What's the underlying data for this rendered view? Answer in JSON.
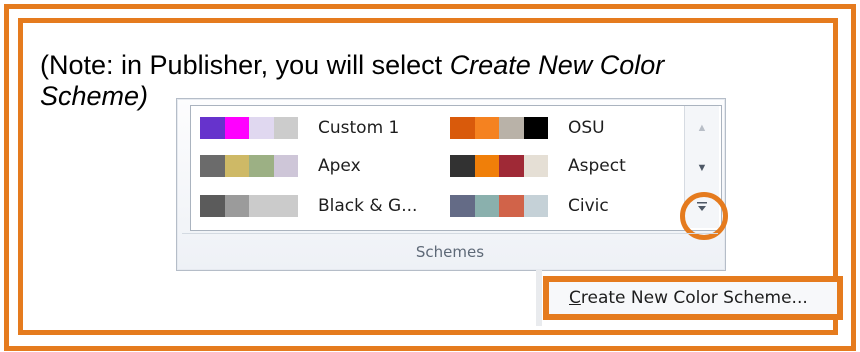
{
  "note": {
    "prefix": "(Note: in Publisher, you will select ",
    "emphasis": "Create New Color Scheme)",
    "first_line_emphasis": "Create New Color",
    "second_line_emphasis": "Scheme)"
  },
  "schemes": [
    {
      "label": "Custom 1",
      "colors": [
        "#6633cc",
        "#ff00ff",
        "#e0d8f0",
        "#cccccc"
      ]
    },
    {
      "label": "OSU",
      "colors": [
        "#d95a0b",
        "#f58220",
        "#b9b2a8",
        "#000000"
      ]
    },
    {
      "label": "Apex",
      "colors": [
        "#6b6b6b",
        "#ceb966",
        "#9cb084",
        "#cec6d8"
      ]
    },
    {
      "label": "Aspect",
      "colors": [
        "#323232",
        "#f07f09",
        "#9f2936",
        "#e5dfd5"
      ]
    },
    {
      "label": "Black & G...",
      "colors": [
        "#5b5b5b",
        "#9b9b9b",
        "#cbcbcb",
        "#cbcbcb"
      ]
    },
    {
      "label": "Civic",
      "colors": [
        "#646b86",
        "#8ab0ad",
        "#d16349",
        "#c5d1d7"
      ]
    }
  ],
  "scrollbar": {
    "up_icon": "▲",
    "down_icon": "▼",
    "more_icon": "▼"
  },
  "group_label": "Schemes",
  "menu": {
    "create_label": "Create New Color Scheme...",
    "access_key": "C",
    "rest": "reate New Color Scheme..."
  },
  "colors": {
    "accent_orange": "#e57b1e"
  }
}
